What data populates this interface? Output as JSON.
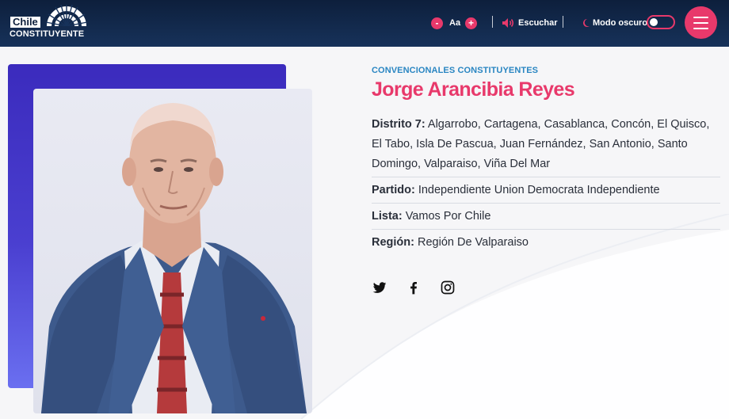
{
  "header": {
    "logo": {
      "line1": "Chile",
      "line2": "CONSTITUYENTE"
    },
    "font_size": {
      "decrease": "-",
      "label": "Aa",
      "increase": "+"
    },
    "listen_label": "Escuchar",
    "dark_mode_label": "Modo oscuro",
    "dark_mode_on": false
  },
  "profile": {
    "kicker": "CONVENCIONALES CONSTITUYENTES",
    "name": "Jorge Arancibia Reyes",
    "fields": [
      {
        "label": "Distrito 7:",
        "value": "Algarrobo, Cartagena, Casablanca, Concón, El Quisco, El Tabo, Isla De Pascua, Juan Fernández, San Antonio, Santo Domingo, Valparaiso, Viña Del Mar"
      },
      {
        "label": "Partido:",
        "value": "Independiente Union Democrata Independiente"
      },
      {
        "label": "Lista:",
        "value": "Vamos Por Chile"
      },
      {
        "label": "Región:",
        "value": "Región De Valparaiso"
      }
    ],
    "socials": [
      "twitter-icon",
      "facebook-icon",
      "instagram-icon"
    ]
  },
  "colors": {
    "accent": "#e8396b",
    "header_bg": "#0d1f3c",
    "kicker": "#2a86c2",
    "photo_frame": "#3b2bbd"
  }
}
